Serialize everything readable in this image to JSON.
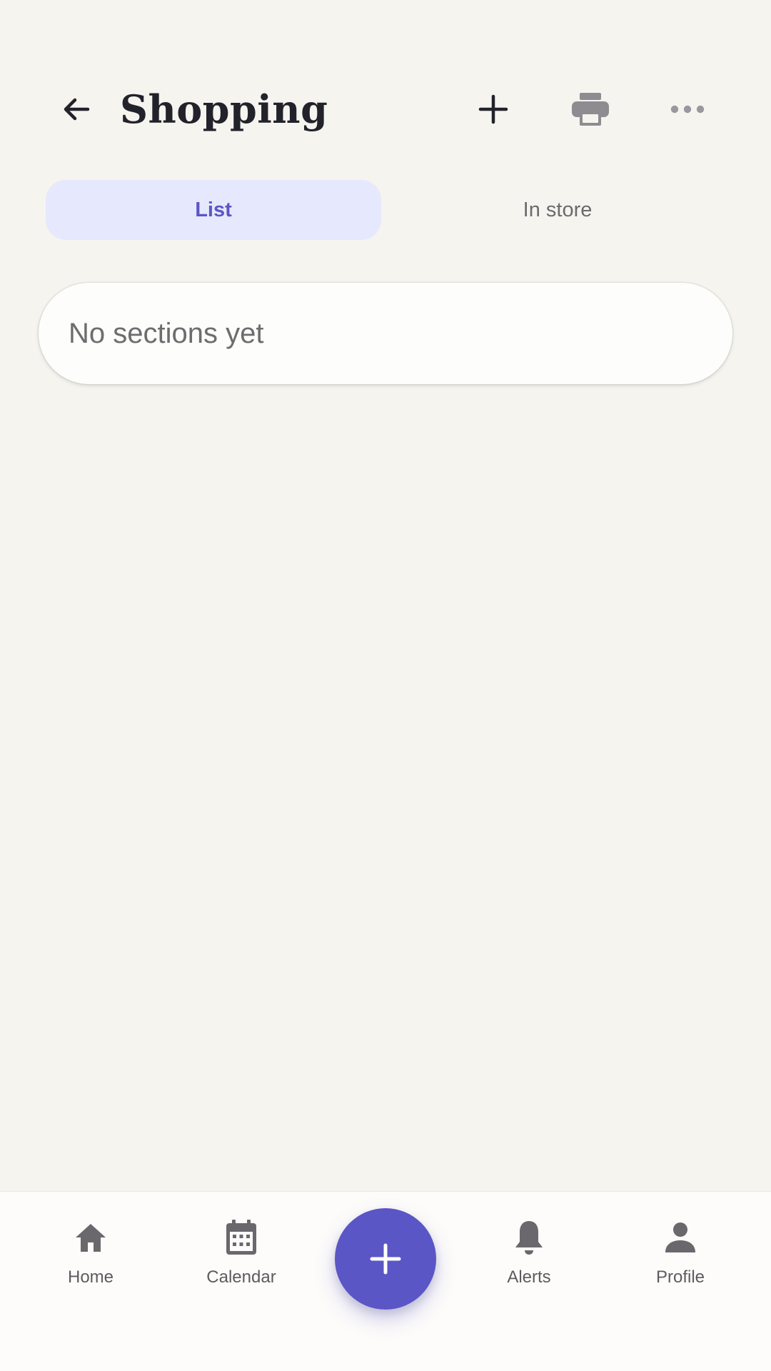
{
  "header": {
    "title": "Shopping",
    "back_icon": "arrow-left-icon",
    "add_icon": "plus-icon",
    "print_icon": "printer-icon",
    "more_icon": "more-horizontal-icon"
  },
  "tabs": [
    {
      "label": "List",
      "active": true
    },
    {
      "label": "In store",
      "active": false
    }
  ],
  "sections": {
    "empty_text": "No sections yet"
  },
  "bottom_nav": {
    "items": [
      {
        "label": "Home",
        "icon": "home-icon"
      },
      {
        "label": "Calendar",
        "icon": "calendar-icon"
      },
      {
        "label": "Alerts",
        "icon": "bell-icon"
      },
      {
        "label": "Profile",
        "icon": "person-icon"
      }
    ],
    "fab_icon": "plus-icon"
  },
  "colors": {
    "accent": "#5a56c6",
    "background": "#f6f4ef",
    "active_tab_bg": "#e6e8fd"
  }
}
